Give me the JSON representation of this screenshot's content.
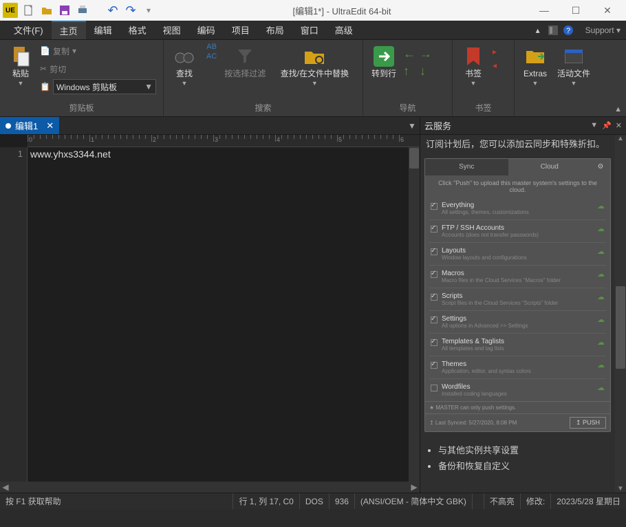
{
  "titlebar": {
    "title": "[编辑1*] - UltraEdit 64-bit"
  },
  "menu": {
    "items": [
      "文件(F)",
      "主页",
      "编辑",
      "格式",
      "视图",
      "编码",
      "项目",
      "布局",
      "窗口",
      "高级"
    ],
    "activeIndex": 1,
    "support": "Support ▾"
  },
  "ribbon": {
    "clipboard": {
      "label": "剪贴板",
      "paste": "粘贴",
      "copy": "复制",
      "cut": "剪切",
      "selector": "Windows 剪贴板"
    },
    "search": {
      "label": "搜索",
      "find": "查找",
      "filter": "按选择过滤",
      "findreplace": "查找/在文件中替换"
    },
    "nav": {
      "label": "导航",
      "goto": "转到行"
    },
    "bookmark": {
      "label": "书签",
      "bookmark": "书签"
    },
    "extras": {
      "extras": "Extras",
      "active": "活动文件"
    }
  },
  "doctab": {
    "name": "编辑1"
  },
  "editor": {
    "line1_num": "1",
    "line1_text": "www.yhxs3344.net"
  },
  "rightpanel": {
    "title": "云服务",
    "desc": "订阅计划后，您可以添加云同步和特殊折扣。",
    "tabs": {
      "sync": "Sync",
      "cloud": "Cloud"
    },
    "syncdesc": "Click \"Push\" to upload this master system's settings to the cloud.",
    "rows": [
      {
        "t": "Everything",
        "s": "All settings, themes, customizations"
      },
      {
        "t": "FTP / SSH Accounts",
        "s": "Accounts (does not transfer passwords)"
      },
      {
        "t": "Layouts",
        "s": "Window layouts and configurations"
      },
      {
        "t": "Macros",
        "s": "Macro files in the Cloud Services \"Macros\" folder"
      },
      {
        "t": "Scripts",
        "s": "Script files in the Cloud Services \"Scripts\" folder"
      },
      {
        "t": "Settings",
        "s": "All options in Advanced >> Settings"
      },
      {
        "t": "Templates & Taglists",
        "s": "All templates and tag lists"
      },
      {
        "t": "Themes",
        "s": "Application, editor, and syntax colors"
      },
      {
        "t": "Wordfiles",
        "s": "Installed coding languages"
      }
    ],
    "master": "★ MASTER can only push settings.",
    "lastsync": "↥ Last Synced: 5/27/2020, 8:08 PM",
    "push": "↥ PUSH",
    "bullets": [
      "与其他实例共享设置",
      "备份和恢复自定义"
    ]
  },
  "status": {
    "help": "按 F1 获取帮助",
    "pos": "行 1, 列 17, C0",
    "os": "DOS",
    "cp": "936",
    "enc": "(ANSI/OEM - 简体中文 GBK)",
    "hl": "不高亮",
    "mod": "修改:",
    "date": "2023/5/28 星期日"
  }
}
